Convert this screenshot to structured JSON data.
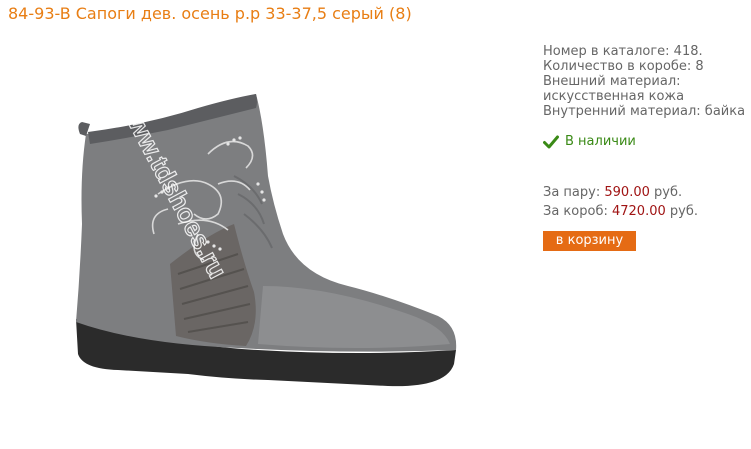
{
  "product": {
    "title": "84-93-B Сапоги дев. осень р.р 33-37,5 серый (8)",
    "watermark": "www.tdshoes.ru"
  },
  "info": {
    "catalog_number": "Номер в каталоге: 418.",
    "box_quantity": "Количество в коробе: 8",
    "outer_material_label": "Внешний материал:",
    "outer_material_value": "искусственная кожа",
    "inner_material": "Внутренний материал: байка"
  },
  "stock": {
    "text": "В наличии",
    "icon": "checkmark-icon",
    "color": "#3a8a16"
  },
  "prices": {
    "pair_label": "За пару:",
    "pair_value": "590.00",
    "box_label": "За короб:",
    "box_value": "4720.00",
    "currency": "руб."
  },
  "cart_button": {
    "label": "в корзину",
    "color": "#e56b14"
  },
  "colors": {
    "title": "#e87e14",
    "price": "#a01414",
    "text": "#666666"
  }
}
